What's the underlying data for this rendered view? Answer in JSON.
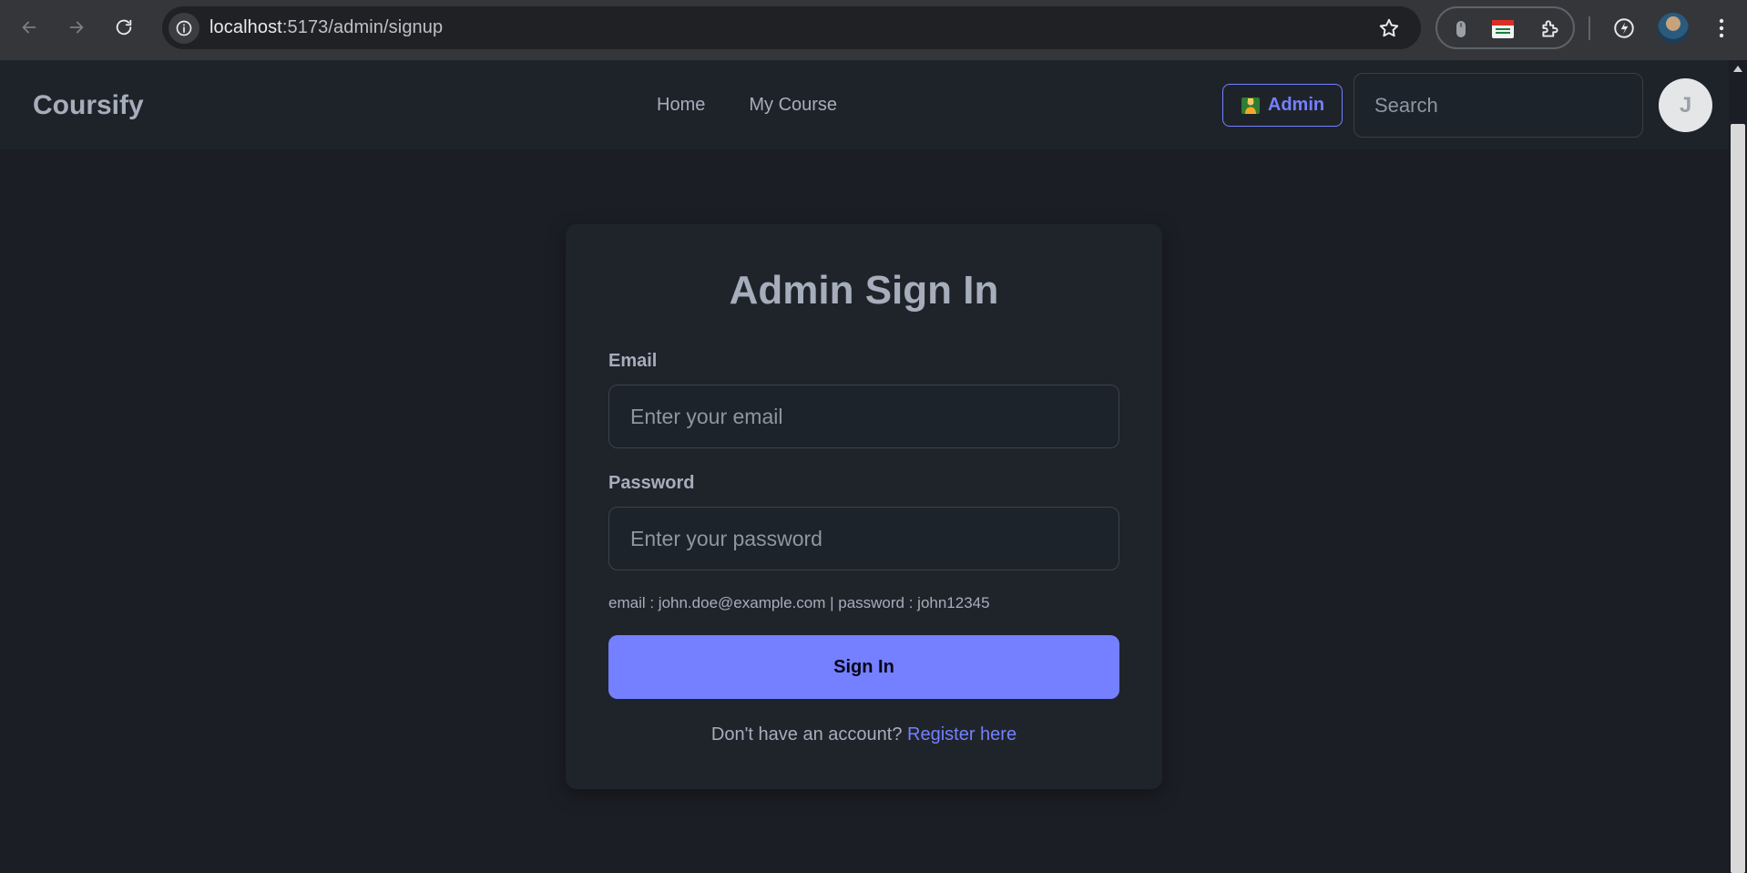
{
  "browser": {
    "url_host": "localhost",
    "url_path": ":5173/admin/signup"
  },
  "navbar": {
    "brand": "Coursify",
    "links": [
      {
        "label": "Home"
      },
      {
        "label": "My Course"
      }
    ],
    "admin_label": "Admin",
    "search_placeholder": "Search",
    "avatar_initial": "J"
  },
  "form": {
    "title": "Admin Sign In",
    "email_label": "Email",
    "email_placeholder": "Enter your email",
    "password_label": "Password",
    "password_placeholder": "Enter your password",
    "hint": "email : john.doe@example.com | password : john12345",
    "submit_label": "Sign In",
    "register_prompt": "Don't have an account?",
    "register_link": "Register here"
  },
  "colors": {
    "accent": "#7480ff",
    "page_bg": "#1b1e24",
    "card_bg": "#1f242b",
    "text": "#a6adbb"
  }
}
